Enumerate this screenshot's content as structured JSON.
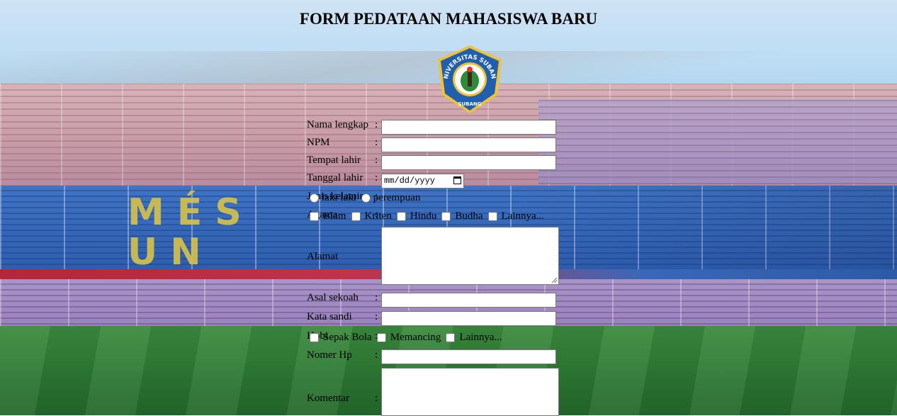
{
  "page": {
    "title": "FORM PEDATAAN MAHASISWA BARU",
    "logo": {
      "icon": "universitas-subang-logo",
      "arc_text": "UNIVERSITAS SUBANG",
      "bottom_text": "SUBANG",
      "colors": {
        "shield": "#1f5fb0",
        "rim": "#f2c230",
        "leaf": "#2e8b3a"
      }
    }
  },
  "form": {
    "nama_lengkap": {
      "label": "Nama lengkap",
      "value": ""
    },
    "npm": {
      "label": "NPM",
      "value": ""
    },
    "tempat_lahir": {
      "label": "Tempat lahir",
      "value": ""
    },
    "tanggal_lahir": {
      "label": "Tanggal lahir",
      "placeholder": "mm/dd/yyyy",
      "icon": "calendar-icon"
    },
    "jenis_kelamin": {
      "label": "Jenis kelamin",
      "options": [
        "laki laki",
        "perempuan"
      ]
    },
    "agama": {
      "label": "Agama",
      "options": [
        "islam",
        "Kriten",
        "Hindu",
        "Budha",
        "Lainnya..."
      ]
    },
    "alamat": {
      "label": "Alamat",
      "value": ""
    },
    "asal_sekolah": {
      "label": "Asal sekoah",
      "value": ""
    },
    "kata_sandi": {
      "label": "Kata sandi",
      "value": ""
    },
    "hobi": {
      "label": "Hobi",
      "options": [
        "Sepak Bola",
        "Memancing",
        "Lainnya..."
      ]
    },
    "nomer_hp": {
      "label": "Nomer Hp",
      "value": ""
    },
    "komentar": {
      "label": "Komentar",
      "value": ""
    },
    "colon": ":"
  }
}
